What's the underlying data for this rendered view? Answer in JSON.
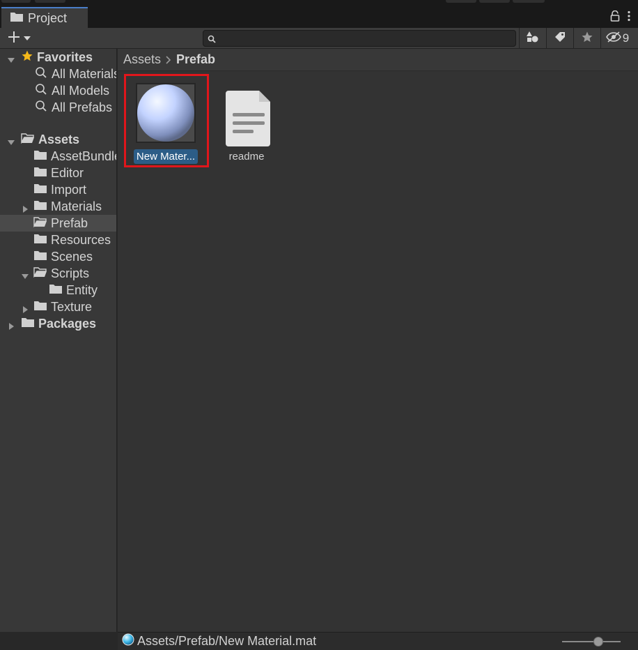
{
  "window": {
    "tab_title": "Project"
  },
  "toolbar": {
    "create_label": "+",
    "search_placeholder": "",
    "search_value": "",
    "hidden_packages_count": "9"
  },
  "favorites": {
    "label": "Favorites",
    "items": [
      {
        "label": "All Materials"
      },
      {
        "label": "All Models"
      },
      {
        "label": "All Prefabs"
      }
    ]
  },
  "assets_tree": {
    "label": "Assets",
    "children": [
      {
        "label": "AssetBundles",
        "expandable": false,
        "selected": false
      },
      {
        "label": "Editor",
        "expandable": false,
        "selected": false
      },
      {
        "label": "Import",
        "expandable": false,
        "selected": false
      },
      {
        "label": "Materials",
        "expandable": true,
        "selected": false
      },
      {
        "label": "Prefab",
        "expandable": false,
        "selected": true
      },
      {
        "label": "Resources",
        "expandable": false,
        "selected": false
      },
      {
        "label": "Scenes",
        "expandable": false,
        "selected": false
      },
      {
        "label": "Scripts",
        "expandable": true,
        "expanded": true,
        "selected": false
      },
      {
        "label": "Entity",
        "expandable": false,
        "selected": false,
        "nested": true
      },
      {
        "label": "Texture",
        "expandable": true,
        "selected": false
      }
    ]
  },
  "packages": {
    "label": "Packages"
  },
  "breadcrumb": {
    "root": "Assets",
    "current": "Prefab"
  },
  "grid_items": [
    {
      "label": "New Mater...",
      "icon": "material-sphere-icon",
      "selected": true
    },
    {
      "label": "readme",
      "icon": "text-document-icon",
      "selected": false
    }
  ],
  "status": {
    "path": "Assets/Prefab/New Material.mat",
    "zoom_fraction": 0.6
  },
  "colors": {
    "selection": "#2c5d87",
    "highlight_box": "#e0161b",
    "tab_accent": "#4a7ec8"
  }
}
